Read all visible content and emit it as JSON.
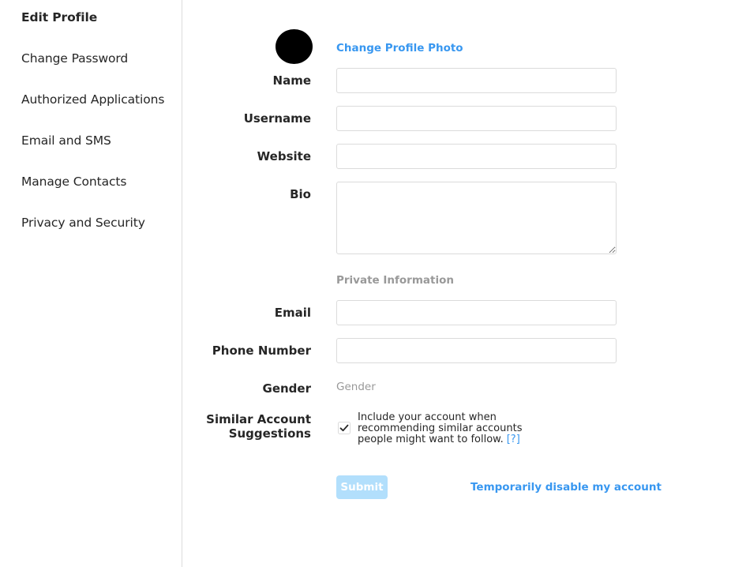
{
  "sidebar": {
    "items": [
      {
        "label": "Edit Profile"
      },
      {
        "label": "Change Password"
      },
      {
        "label": "Authorized Applications"
      },
      {
        "label": "Email and SMS"
      },
      {
        "label": "Manage Contacts"
      },
      {
        "label": "Privacy and Security"
      }
    ]
  },
  "profile": {
    "change_photo_label": "Change Profile Photo"
  },
  "form": {
    "name_label": "Name",
    "name_value": "",
    "username_label": "Username",
    "username_value": "",
    "website_label": "Website",
    "website_value": "",
    "bio_label": "Bio",
    "bio_value": "",
    "private_heading": "Private Information",
    "email_label": "Email",
    "email_value": "",
    "phone_label": "Phone Number",
    "phone_value": "",
    "gender_label": "Gender",
    "gender_value": "Gender",
    "suggestions_label_line1": "Similar Account",
    "suggestions_label_line2": "Suggestions",
    "suggestions_text": "Include your account when recommending similar accounts people might want to follow.",
    "suggestions_help": "[?]",
    "suggestions_checked": true,
    "submit_label": "Submit",
    "disable_label": "Temporarily disable my account"
  },
  "colors": {
    "accent": "#3897f0",
    "submit_disabled": "#b2dffc",
    "muted": "#999999",
    "border": "#dbdbdb"
  }
}
